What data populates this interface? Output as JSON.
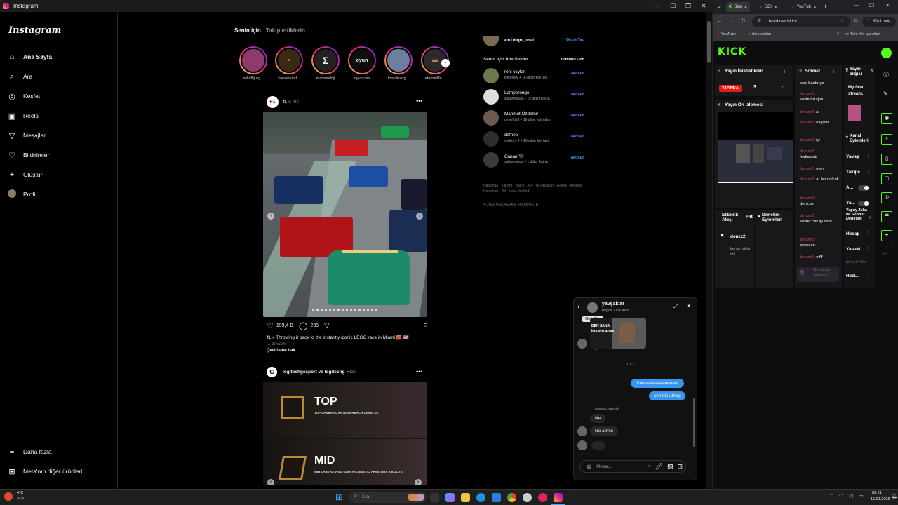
{
  "window": {
    "title": "Instagram"
  },
  "sidebar": {
    "logo": "Instagram",
    "items": [
      {
        "label": "Ana Sayfa",
        "icon": "home-icon"
      },
      {
        "label": "Ara",
        "icon": "search-icon"
      },
      {
        "label": "Keşfet",
        "icon": "compass-icon"
      },
      {
        "label": "Reels",
        "icon": "reels-icon"
      },
      {
        "label": "Mesajlar",
        "icon": "send-icon"
      },
      {
        "label": "Bildirimler",
        "icon": "heart-icon"
      },
      {
        "label": "Oluştur",
        "icon": "plus-icon"
      },
      {
        "label": "Profil",
        "icon": "avatar-icon"
      }
    ],
    "more": "Daha fazla",
    "meta": "Meta'nın diğer ürünleri"
  },
  "feed": {
    "tabs": [
      "Senin için",
      "Takip ettiklerin"
    ],
    "stories": [
      {
        "name": "eylulllgurg..."
      },
      {
        "name": "karaeskied..."
      },
      {
        "name": "matemeloji"
      },
      {
        "name": "oyuncom",
        "avatar_text": "oyun"
      },
      {
        "name": "toprakrazg..."
      },
      {
        "name": "eternallife..."
      }
    ],
    "post1": {
      "author": "f1",
      "time": "8s",
      "likes": "199,4 B",
      "comments": "235",
      "caption_user": "f1",
      "caption": "Throwing it back to the instantly iconic LEGO race in Miami 🧱 🇺🇸",
      "more": "... devamı",
      "translate": "Çevirisine bak"
    },
    "post2": {
      "author": "logitechgesport ve logitechg",
      "time": "23s",
      "banner1_title": "TOP",
      "banner1_sub": "TOP LANERS CAN NOW REACH LEVEL 20",
      "banner2_title": "MID",
      "banner2_sub": "MID LANERS WILL GAIN ACCESS TO FREE TIER 3 BOOTS"
    }
  },
  "suggestions": {
    "current_user": "em1rhqn_unal",
    "switch": "Geçiş Yap",
    "header": "Senin için önerilenler",
    "see_all": "Tümünü Gör",
    "follow": "Takip Et",
    "items": [
      {
        "user": "roni ceylan",
        "sub": "elfecesw + 16 diğer kişi tak"
      },
      {
        "user": "Lamperouge",
        "sub": "sultannakca + 19 diğer kişi ta"
      },
      {
        "user": "Mahmut Özdemir",
        "sub": "omerfg03 + 19 diğer kişi takip"
      },
      {
        "user": "defnee",
        "sub": "melism_0 + 16 diğer kişi taki"
      },
      {
        "user": "Canan 🖤",
        "sub": "sultannakca + 1 diğer kişi ta"
      }
    ],
    "footer_links": "Hakkında · Yardım · Basın · API · İş Fırsatları · Gizlilik · Koşullar · Konumlar · Dil · Meta Verified",
    "copyright": "© 2026 INSTAGRAM FROM META"
  },
  "chat": {
    "title": "yavşaklar",
    "subtitle": "Bugün 2 kişi aktif",
    "tooltip": "Geri Dön",
    "meme_text": "BEN SANA İNANIYORUM",
    "time": "02:21",
    "messages_out": [
      "ömeeeeeeeeeeeeeer",
      "seninki atmış"
    ],
    "sender_label": "utangaç yavşak",
    "messages_in": [
      "Ne",
      "Ne atmış"
    ],
    "placeholder": "Mesaj..."
  },
  "browser": {
    "tabs": [
      "Stre",
      "GEI",
      "YouTub"
    ],
    "url": "dashboard.kick...",
    "incognito": "Gizli mod",
    "bookmarks": [
      "YouTube",
      "ders notları",
      "Tüm Yer İşaretleri"
    ],
    "kick": {
      "logo": "KICK",
      "stats_title": "Yayın İstatistikleri",
      "live_badge": "YAYINDA",
      "viewers": "3",
      "dash": "-",
      "preview_title": "Yayın Ön İzlemesi",
      "chat_title": "Sohbet",
      "chat_lines": [
        {
          "user": "",
          "text": "seni bastırıyo"
        },
        {
          "user": "denizz2:",
          "text": "kesfetini sjim"
        },
        {
          "user": "denizz2:",
          "text": "at"
        },
        {
          "user": "denizz2:",
          "text": "o iyiydi"
        },
        {
          "user": "denizz2:",
          "text": "iyi"
        },
        {
          "user": "denizz2:",
          "text": "fevkalade"
        },
        {
          "user": "denizz2:",
          "text": "ouyy"
        },
        {
          "user": "denizz2:",
          "text": "at lan nolcak"
        },
        {
          "user": "denizz2:",
          "text": "denicez"
        },
        {
          "user": "denizz2:",
          "text": "kesfet cok iyi oldu"
        },
        {
          "user": "denizz2:",
          "text": "ayseeee"
        },
        {
          "user": "denizz2:",
          "text": "offff"
        }
      ],
      "chat_placeholder": "Bir mesaj gönderin",
      "stream_info_title": "Yayın bilgisi",
      "stream_title": "My first stream.",
      "channel_actions": "Kanal Eylemleri",
      "actions": [
        "Yavaş",
        "Takipç",
        "A...",
        "Ya...",
        "Yapay Zeka ile Sohbet Denetimi",
        "Hesap",
        "Yasakl",
        "İzleyici Yön",
        "Hed..."
      ],
      "activity_title": "Etkinlik Akışı",
      "filter": "Filt",
      "mod_actions": "Denetim Eylemleri",
      "activity_user": "denzz2",
      "activity_text": "kanalı takip etti"
    }
  },
  "taskbar": {
    "weather_temp": "4°C",
    "weather_desc": "Açık",
    "search": "Ara",
    "time": "02:21",
    "date": "15.01.2026"
  }
}
